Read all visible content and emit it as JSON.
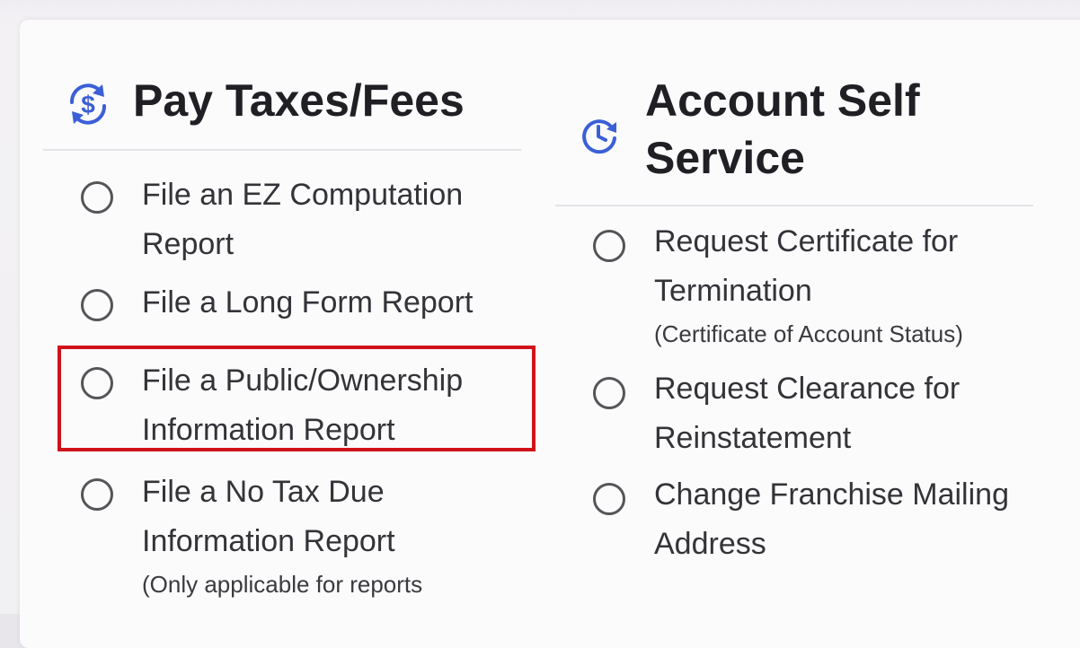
{
  "pay": {
    "title": "Pay Taxes/Fees",
    "icon": "dollar-refresh-icon",
    "options": [
      {
        "label_line1": "File an EZ Computation",
        "label_line2": "Report"
      },
      {
        "label_line1": "File a Long Form Report"
      },
      {
        "label_line1": "File a Public/Ownership",
        "label_line2": "Information Report"
      },
      {
        "label_line1": "File a No Tax Due",
        "label_line2": "Information Report",
        "note": "(Only applicable for reports"
      }
    ]
  },
  "account": {
    "title_line1": "Account Self",
    "title_line2": "Service",
    "icon": "clock-refresh-icon",
    "options": [
      {
        "label_line1": "Request Certificate for",
        "label_line2": "Termination",
        "note": "(Certificate of Account Status)"
      },
      {
        "label_line1": "Request Clearance for",
        "label_line2": "Reinstatement"
      },
      {
        "label_line1": "Change Franchise Mailing",
        "label_line2": "Address"
      }
    ]
  },
  "colors": {
    "accent_icon": "#3b5fd6",
    "highlight": "#d0121b",
    "text": "#333338"
  }
}
